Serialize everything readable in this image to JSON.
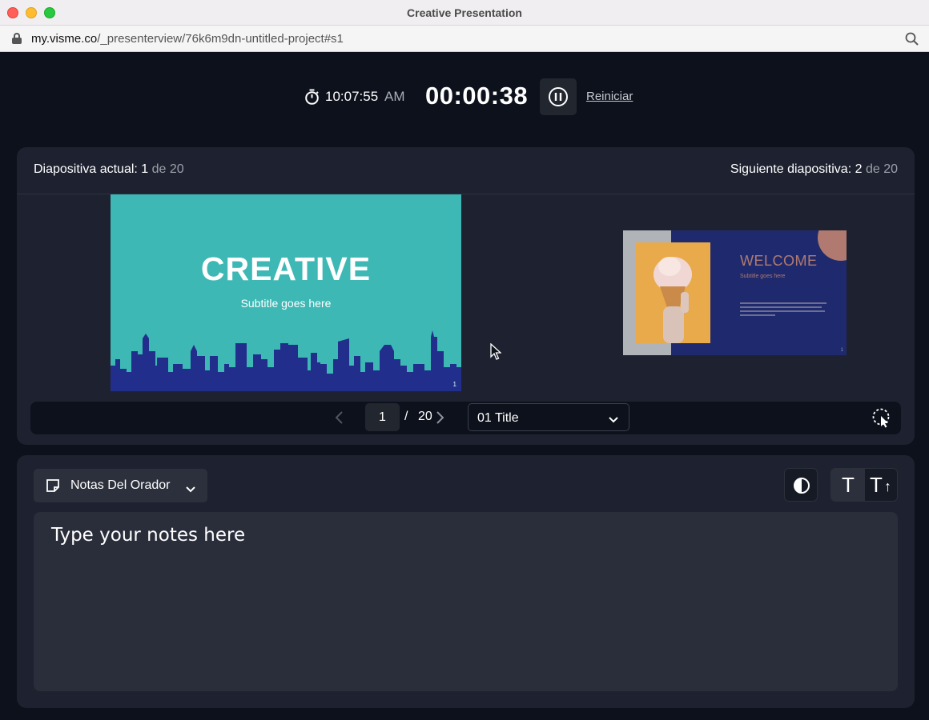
{
  "window": {
    "title": "Creative Presentation",
    "url_host": "my.visme.co",
    "url_path": "/_presenterview/76k6m9dn-untitled-project#s1"
  },
  "timer": {
    "clock_time": "10:07:55",
    "clock_ampm": "AM",
    "elapsed": "00:00:38",
    "restart_label": "Reiniciar"
  },
  "slides": {
    "current_label": "Diapositiva actual:",
    "current_number": "1",
    "current_of": "de 20",
    "next_label": "Siguiente diapositiva:",
    "next_number": "2",
    "next_of": "de 20",
    "current_slide": {
      "title": "CREATIVE",
      "subtitle": "Subtitle goes here",
      "page": "1"
    },
    "next_slide": {
      "title": "WELCOME",
      "subtitle": "Subtitle goes here",
      "page": "1"
    }
  },
  "navigator": {
    "page_value": "1",
    "separator": "/",
    "total": "20",
    "selected_slide": "01 Title"
  },
  "notes": {
    "dropdown_label": "Notas Del Orador",
    "placeholder": "Type your notes here",
    "text_small_label": "T",
    "text_large_label": "T"
  },
  "colors": {
    "background": "#0c111b",
    "panel": "#1e2230",
    "slide_teal": "#3db8b5",
    "slide_navy": "#1f2a6e",
    "accent_rose": "#b07a70"
  },
  "icons": {
    "timer": "stopwatch-icon",
    "pause": "pause-icon",
    "prev": "chevron-left-icon",
    "next": "chevron-right-icon",
    "dropdown": "chevron-down-icon",
    "pointer": "laser-pointer-icon",
    "notes": "sticky-note-icon",
    "contrast": "contrast-icon",
    "search": "search-icon",
    "lock": "lock-icon"
  }
}
